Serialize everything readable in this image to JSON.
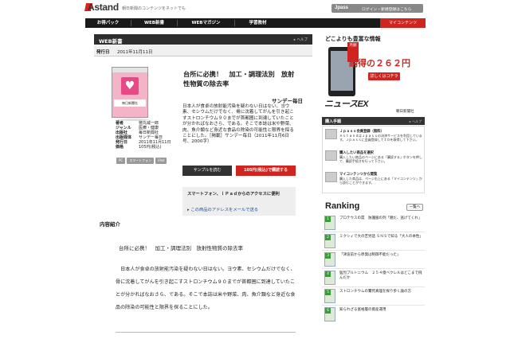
{
  "header": {
    "logo": "Astand",
    "tagline": "朝日新聞のコンテンツをネットでも",
    "jpass": "Jpass",
    "jpass_link": "ログイン・新規登録はこちら",
    "mycontents": "マイコンテンツ"
  },
  "nav": {
    "items": [
      "お得パック",
      "WEB新書",
      "WEBマガジン",
      "学習教材"
    ]
  },
  "section": {
    "title": "WEB新書",
    "help": "ヘルプ",
    "release_label": "発行日",
    "release_date": "2011年11月11日"
  },
  "book": {
    "title": "台所に必携！　加工・調理法別　放射性物質の除去率",
    "cover_label": "毎日新聞社",
    "publisher_logo": "サンデー毎日",
    "description": "日本人が食卓の放射能汚染を疑わない日はない。ヨウ素、セシウムだけでなく、骨に沈着してがんを引き起こすストロンチウム９０までが首都圏に到達していたことが分かればなおさら、である。そこで本誌は米や野菜、肉、魚介類など身近な食品の除染の可能性と限界を探ることにした。［掲載］サンデー毎日（2011年11月6日号、2000字）",
    "meta": [
      {
        "key": "著者",
        "value": "徳丸威一郎"
      },
      {
        "key": "ジャンル",
        "value": "医療・健康"
      },
      {
        "key": "出版社",
        "value": "毎日新聞社"
      },
      {
        "key": "出版媒体",
        "value": "サンデー毎日"
      },
      {
        "key": "発行日",
        "value": "2011年11月11日"
      },
      {
        "key": "価格",
        "value": "105円(税込)"
      }
    ],
    "tags": [
      "PC",
      "スマートフォン",
      "iPad"
    ],
    "sample_button": "サンプルを読む",
    "buy_button": "105円(税込)で購読する"
  },
  "access": {
    "text": "スマートフォン、ｉＰａｄからのアクセスに便利",
    "link": "この商品のアドレスをメールで送る"
  },
  "intro": {
    "header": "内容紹介",
    "title": "台所に必携！　加工・調理法別　放射性物質の除去率",
    "body": "　日本人が食卓の放射能汚染を疑わない日はない。ヨウ素、セシウムだけでなく、骨に沈着してがんを引き起こすストロンチウム９０までが首都圏に到達していたことが分かればなおさら、である。そこで本誌は米や野菜、肉、魚介類など身近な食品の除染の可能性と限界を探ることにした。"
  },
  "ad": {
    "tagline": "どこよりも豊富な情報",
    "badge": "月額",
    "price": "納得の２６２円",
    "more": "詳しくはコチラ",
    "news": "ニュースEX",
    "publisher": "朝日新聞社"
  },
  "guide": {
    "title": "購入手順",
    "help": "ヘルプ",
    "steps": [
      {
        "title": "Ｊｐａｓｓ会員登録（無料）",
        "text": "ＡｓｔａｎｄはＪｐａｓｓの決済サービスを利用しています。Ｊｐａｓｓに会員登録してＩＤを取得して下さい。"
      },
      {
        "title": "購入したい商品を選択",
        "text": "購入したい商品のページにある「購読する」ボタンを押して、購読手続きを行って下さい。"
      },
      {
        "title": "マイコンテンツから閲覧",
        "text": "購入した商品は、ページ右上にある「マイコンテンツ」から読むことができます。"
      }
    ]
  },
  "ranking": {
    "title": "Ranking",
    "all_label": "一覧へ",
    "items": [
      {
        "rank": "1",
        "text": "プロテウスの罠　防護服の列「親だ、逃げてくれ」"
      },
      {
        "rank": "2",
        "text": "ミクシィで大の苦労話 ＳＮＳで知る「大人の本性」"
      },
      {
        "rank": "3",
        "text": "「津波前から原発は制御不能だった」"
      },
      {
        "rank": "4",
        "text": "猛烈プルトニウム　２５４億ベクレルはどこまで飛んだか"
      },
      {
        "rank": "5",
        "text": "ストロンチウムの驚愕真理を探り歩く論の方"
      },
      {
        "rank": "6",
        "text": "知られざる富裕層の資産運用"
      }
    ]
  }
}
